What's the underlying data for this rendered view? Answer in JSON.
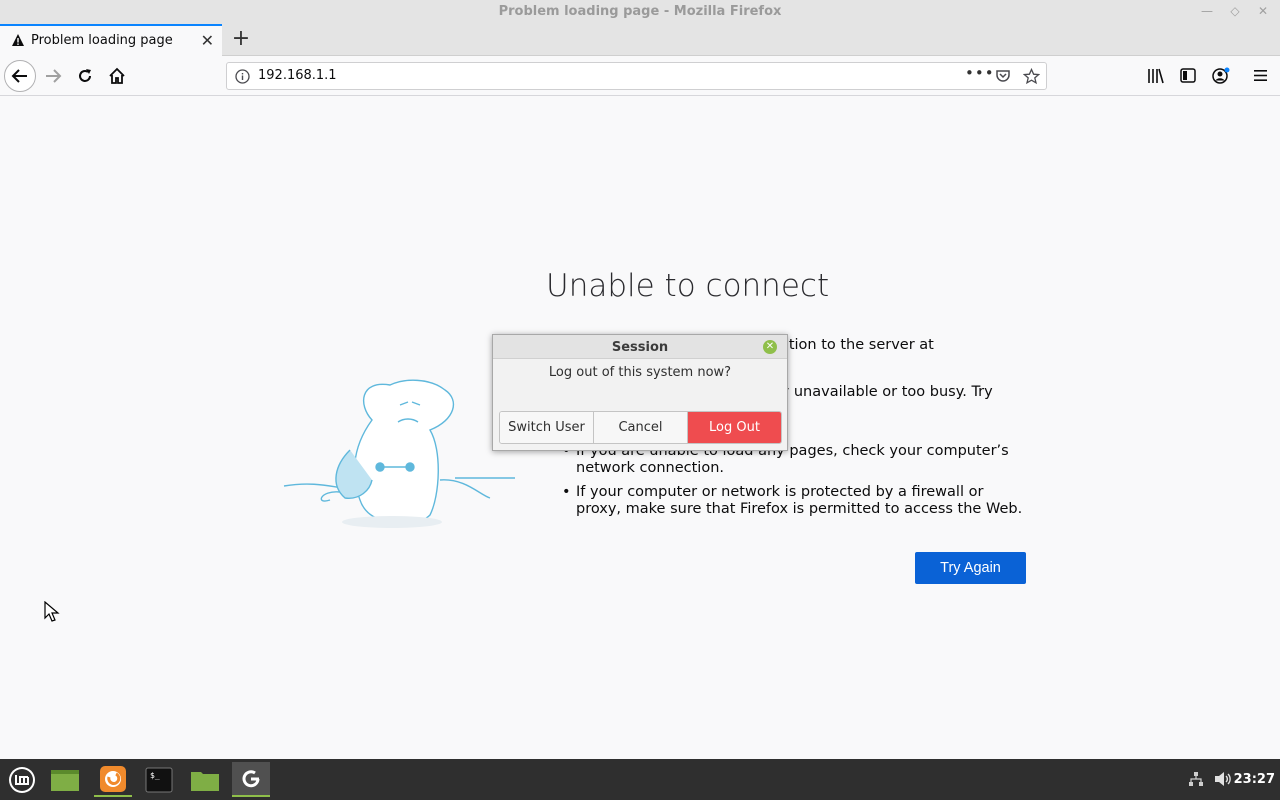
{
  "window": {
    "title": "Problem loading page - Mozilla Firefox"
  },
  "tabs": [
    {
      "label": "Problem loading page",
      "icon": "warning-icon"
    }
  ],
  "nav": {
    "url": "192.168.1.1"
  },
  "error": {
    "headline": "Unable to connect",
    "intro": "Firefox can’t establish a connection to the server at 192.168.1.1.",
    "bullets": [
      "The site could be temporarily unavailable or too busy. Try again in a few moments.",
      "If you are unable to load any pages, check your computer’s network connection.",
      "If your computer or network is protected by a firewall or proxy, make sure that Firefox is permitted to access the Web."
    ],
    "try_again_label": "Try Again"
  },
  "dialog": {
    "title": "Session",
    "message": "Log out of this system now?",
    "buttons": {
      "switch_user": "Switch User",
      "cancel": "Cancel",
      "log_out": "Log Out"
    }
  },
  "taskbar": {
    "items": [
      "menu-icon",
      "show-desktop-icon",
      "firefox-icon",
      "terminal-icon",
      "files-icon",
      "update-manager-icon"
    ],
    "clock": "23:27"
  },
  "colors": {
    "accent_blue": "#0a62d6",
    "logout_red": "#ef4c4f",
    "mint_green": "#8fbf4a",
    "taskbar": "#2f2f2f"
  }
}
